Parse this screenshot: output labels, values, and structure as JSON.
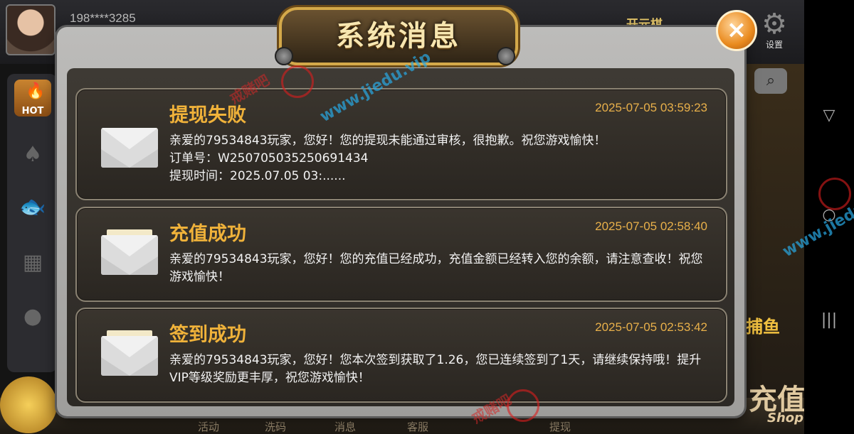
{
  "header": {
    "user_id": "198****3285",
    "brand": "开元棋",
    "settings_label": "设置"
  },
  "sidebar": {
    "hot_label": "HOT"
  },
  "right": {
    "fish_label": "捕鱼",
    "recharge_label": "充值",
    "shop_label": "Shop"
  },
  "bottom_tabs": [
    "活动",
    "洗码",
    "消息",
    "客服",
    "提现"
  ],
  "dialog": {
    "title": "系统消息",
    "close_icon": "×",
    "messages": [
      {
        "title": "提现失败",
        "time": "2025-07-05 03:59:23",
        "body": "亲爱的79534843玩家，您好！您的提现未能通过审核，很抱歉。祝您游戏愉快！\n订单号：W250705035250691434\n提现时间：2025.07.05 03:......"
      },
      {
        "title": "充值成功",
        "time": "2025-07-05 02:58:40",
        "body": "亲爱的79534843玩家，您好！您的充值已经成功，充值金额已经转入您的余额，请注意查收！祝您游戏愉快！"
      },
      {
        "title": "签到成功",
        "time": "2025-07-05 02:53:42",
        "body": "亲爱的79534843玩家，您好！您本次签到获取了1.26，您已连续签到了1天，请继续保持哦！提升VIP等级奖励更丰厚，祝您游戏愉快！"
      }
    ]
  },
  "watermark": {
    "text": "戒赌吧",
    "url": "www.jiedu.vip"
  },
  "colors": {
    "accent": "#f0b23a",
    "time": "#e8b04a",
    "close": "#e98a1e"
  }
}
